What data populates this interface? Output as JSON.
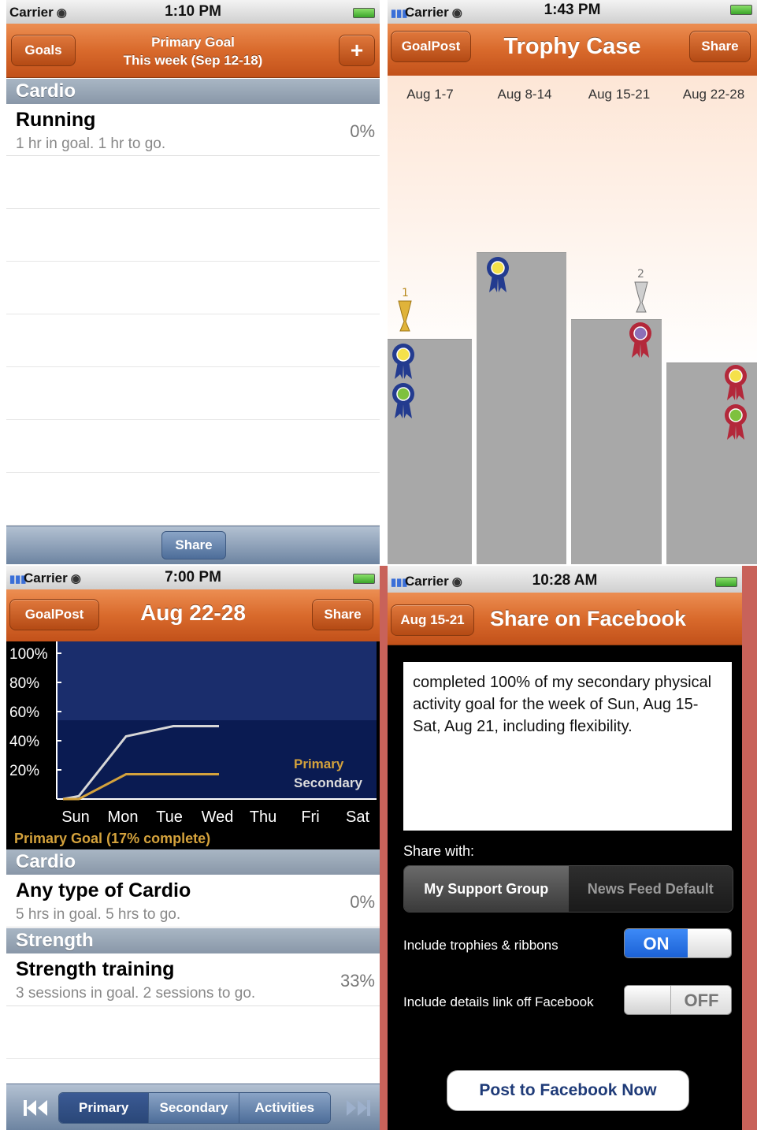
{
  "screen1": {
    "status": {
      "carrier": "Carrier",
      "time": "1:10 PM"
    },
    "nav": {
      "back": "Goals",
      "title_line1": "Primary Goal",
      "title_line2": "This week (Sep 12-18)",
      "add": "+"
    },
    "section": "Cardio",
    "row": {
      "title": "Running",
      "subtitle": "1 hr in goal. 1 hr to go.",
      "percent": "0%"
    },
    "toolbar_button": "Share"
  },
  "screen2": {
    "status": {
      "carrier": "Carrier",
      "time": "1:43 PM"
    },
    "nav": {
      "back": "GoalPost",
      "title": "Trophy Case",
      "share": "Share"
    },
    "weeks": [
      "Aug 1-7",
      "Aug 8-14",
      "Aug 15-21",
      "Aug 22-28"
    ],
    "trophy_numbers": [
      "1",
      "2"
    ],
    "colors": {
      "blue_ribbon": "#233b8f",
      "red_ribbon": "#b3283a",
      "yellow_center": "#f5e14a",
      "green_center": "#7ec13e",
      "purple_center": "#8c70b8",
      "podium": "#a8a8a8"
    }
  },
  "screen3": {
    "status": {
      "carrier": "Carrier",
      "time": "7:00 PM"
    },
    "nav": {
      "back": "GoalPost",
      "title": "Aug 22-28",
      "share": "Share"
    },
    "chart_data": {
      "type": "line",
      "title": "",
      "xlabel": "",
      "ylabel": "",
      "categories": [
        "Sun",
        "Mon",
        "Tue",
        "Wed",
        "Thu",
        "Fri",
        "Sat"
      ],
      "y_ticks": [
        "100%",
        "80%",
        "60%",
        "40%",
        "20%"
      ],
      "ylim": [
        0,
        100
      ],
      "series": [
        {
          "name": "Primary",
          "color": "#d4a23c",
          "values": [
            0,
            0,
            17,
            17,
            17
          ]
        },
        {
          "name": "Secondary",
          "color": "#d7d7d7",
          "values": [
            0,
            2,
            43,
            50,
            50
          ]
        }
      ],
      "footer": "Primary Goal (17% complete)"
    },
    "sections": [
      {
        "title": "Cardio",
        "row": {
          "title": "Any type of Cardio",
          "subtitle": "5 hrs in goal. 5 hrs to go.",
          "percent": "0%"
        }
      },
      {
        "title": "Strength",
        "row": {
          "title": "Strength training",
          "subtitle": "3 sessions in goal. 2 sessions to go.",
          "percent": "33%"
        }
      }
    ],
    "segments": [
      "Primary",
      "Secondary",
      "Activities"
    ],
    "icons": {
      "prev": "skip-back-icon",
      "next": "skip-forward-icon"
    }
  },
  "screen4": {
    "status": {
      "carrier": "Carrier",
      "time": "10:28 AM"
    },
    "nav": {
      "back": "Aug 15-21",
      "title": "Share on Facebook"
    },
    "message": "completed 100% of my secondary physical activity goal for the week of Sun, Aug 15-Sat, Aug 21, including flexibility.",
    "share_with": "Share with:",
    "share_options": [
      "My Support Group",
      "News Feed Default"
    ],
    "option1": {
      "label": "Include trophies & ribbons",
      "state": "ON"
    },
    "option2": {
      "label": "Include details link off Facebook",
      "state": "OFF"
    },
    "post_button": "Post to Facebook Now"
  }
}
